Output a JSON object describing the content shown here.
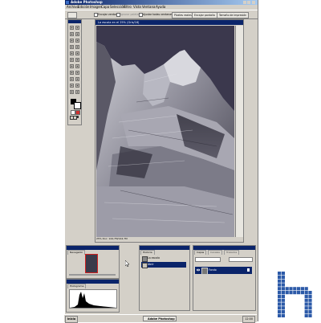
{
  "window": {
    "title": "Adobe Photoshop"
  },
  "menubar": {
    "items": [
      "Archivo",
      "Edición",
      "Imagen",
      "Capa",
      "Selección",
      "Filtro",
      "Vista",
      "Ventana",
      "Ayuda"
    ]
  },
  "options_bar": {
    "resize_windows_label": "Encajar ventana",
    "ignore_palettes_label": "Ignorar paletas",
    "all_windows_label": "Ajustar todas ventanas",
    "actual_pixels_button": "Píxeles reales",
    "fit_screen_button": "Encajar pantalla",
    "print_size_button": "Tamaño de impresión"
  },
  "document": {
    "title": "La escala en el 25% (Gris/16)",
    "status": "25%   Doc: 144,7M/144,7M"
  },
  "panels": {
    "navigator_tab": "Navegador",
    "histogram_tab": "Histograma",
    "history_tab": "Historia",
    "history_items": [
      "La escala",
      "Abrir"
    ],
    "layers_tab": "Capas",
    "channels_tab": "Canales",
    "paths_tab": "Trazados",
    "layer_name": "Fondo"
  },
  "taskbar": {
    "start_label": "Inicio",
    "app_label": "Adobe Photoshop",
    "clock": "12:00"
  },
  "colors": {
    "titlebar": "#0a246a",
    "selection": "#0a246a",
    "chrome": "#d4d0c8",
    "logo_blue": "#2c5aa8"
  },
  "icons": {
    "toolbox": [
      "marquee-icon",
      "move-icon",
      "lasso-icon",
      "magic-wand-icon",
      "crop-icon",
      "slice-icon",
      "healing-brush-icon",
      "brush-icon",
      "clone-stamp-icon",
      "history-brush-icon",
      "eraser-icon",
      "gradient-icon",
      "blur-icon",
      "dodge-icon",
      "path-select-icon",
      "type-icon",
      "pen-icon",
      "shape-icon",
      "notes-icon",
      "eyedropper-icon",
      "hand-icon",
      "zoom-icon"
    ]
  }
}
